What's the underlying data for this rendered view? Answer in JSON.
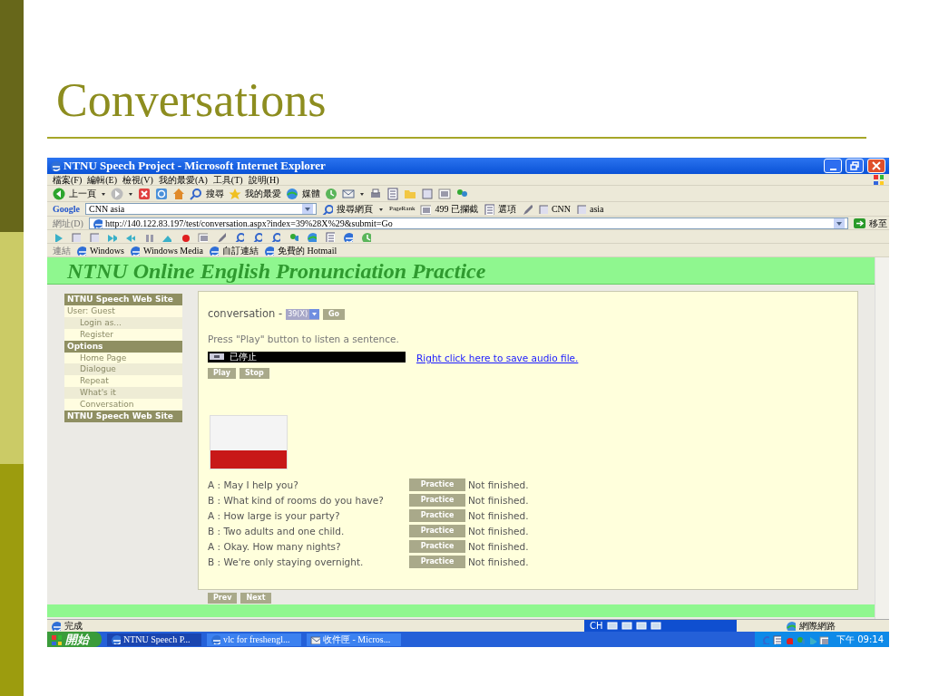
{
  "slide": {
    "title": "Conversations"
  },
  "window": {
    "title": "NTNU Speech Project - Microsoft Internet Explorer",
    "menu": [
      "檔案(F)",
      "編輯(E)",
      "檢視(V)",
      "我的最愛(A)",
      "工具(T)",
      "說明(H)"
    ],
    "toolbar": [
      "上一頁",
      "搜尋",
      "我的最愛",
      "媒體"
    ],
    "google_bar": {
      "logo": "Google",
      "search_value": "CNN asia",
      "search_button": "搜尋網頁",
      "pagerank": "PageRank",
      "blocked": "499 已攔截",
      "options": "選項",
      "bookmarks": [
        "CNN",
        "asia"
      ]
    },
    "address_bar": {
      "label": "網址(D)",
      "url": "http://140.122.83.197/test/conversation.aspx?index=39%28X%29&submit=Go",
      "go": "移至"
    },
    "links_bar": {
      "label": "連結",
      "links": [
        "Windows",
        "Windows Media",
        "自訂連結",
        "免費的 Hotmail"
      ]
    },
    "page": {
      "banner": "NTNU Online English Pronunciation Practice",
      "sidebar": [
        {
          "kind": "header",
          "label": "NTNU Speech Web Site"
        },
        {
          "kind": "label",
          "label": "User: Guest"
        },
        {
          "kind": "link",
          "label": "Login as..."
        },
        {
          "kind": "link",
          "label": "Register"
        },
        {
          "kind": "header",
          "label": "Options"
        },
        {
          "kind": "link",
          "label": "Home Page"
        },
        {
          "kind": "link",
          "label": "Dialogue"
        },
        {
          "kind": "link",
          "label": "Repeat"
        },
        {
          "kind": "link",
          "label": "What's it"
        },
        {
          "kind": "link",
          "label": "Conversation"
        },
        {
          "kind": "header",
          "label": "NTNU Speech Web Site"
        }
      ],
      "conversation_label": "conversation -",
      "conversation_select": "39(X)",
      "go_button": "Go",
      "instruction": "Press \"Play\" button to listen a sentence.",
      "player_status": "已停止",
      "save_link": "Right click here to save audio file.",
      "player_buttons": [
        "Play",
        "Stop"
      ],
      "lines": [
        {
          "text": "A : May I help you?",
          "button": "Practice",
          "status": "Not finished."
        },
        {
          "text": "B : What kind of rooms do you have?",
          "button": "Practice",
          "status": "Not finished."
        },
        {
          "text": "A : How large is your party?",
          "button": "Practice",
          "status": "Not finished."
        },
        {
          "text": "B : Two adults and one child.",
          "button": "Practice",
          "status": "Not finished."
        },
        {
          "text": "A : Okay. How many nights?",
          "button": "Practice",
          "status": "Not finished."
        },
        {
          "text": "B : We're only staying overnight.",
          "button": "Practice",
          "status": "Not finished."
        }
      ],
      "nav_buttons": [
        "Prev",
        "Next"
      ]
    },
    "status_bar": {
      "status": "完成",
      "language": "CH",
      "zone": "網際網路"
    },
    "taskbar": {
      "start": "開始",
      "tasks": [
        {
          "label": "NTNU Speech P...",
          "selected": true
        },
        {
          "label": "vlc for freshengl...",
          "selected": false
        },
        {
          "label": "收件匣 - Micros...",
          "selected": false
        }
      ],
      "clock": "下午 09:14"
    }
  }
}
